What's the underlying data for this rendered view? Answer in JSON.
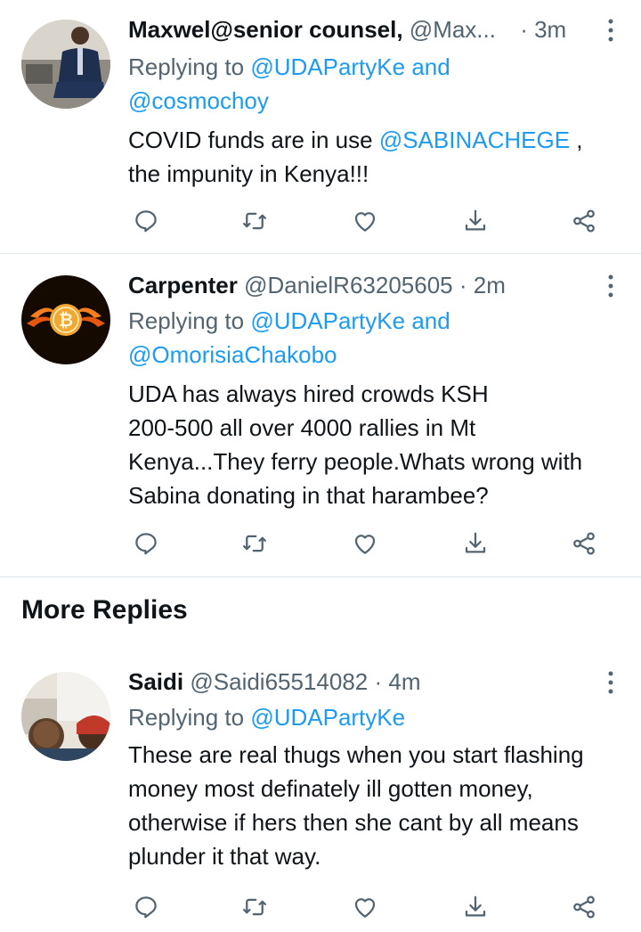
{
  "tweets": [
    {
      "name": "Maxwel@senior counsel,",
      "handle": "@Max...",
      "time": "· 3m",
      "replying_prefix": "Replying to",
      "replying_1": "@UDAPartyKe",
      "replying_and": "and",
      "replying_2": "@cosmochoy",
      "text_1": "COVID funds are in use ",
      "text_mention": "@SABINACHEGE",
      "text_2": " ,",
      "text_3": "the impunity in Kenya!!!"
    },
    {
      "name": "Carpenter",
      "handle": "@DanielR63205605",
      "time": "· 2m",
      "replying_prefix": "Replying to",
      "replying_1": "@UDAPartyKe",
      "replying_and": "and",
      "replying_2": "@OmorisiaChakobo",
      "line_1": "UDA has always hired crowds KSH",
      "line_2": "200-500 all over 4000 rallies in Mt",
      "line_3": "Kenya...They ferry people.Whats wrong with",
      "line_4": "Sabina donating in that harambee?"
    },
    {
      "name": "Saidi",
      "handle": "@Saidi65514082",
      "time": "· 4m",
      "replying_prefix": "Replying to",
      "replying_1": "@UDAPartyKe",
      "line_1": "These are real thugs when you start flashing",
      "line_2": "money most definately ill gotten money,",
      "line_3": "otherwise if hers then she cant by all means",
      "line_4": "plunder it that way."
    }
  ],
  "section": {
    "more_replies": "More Replies"
  },
  "icons": {
    "reply": "reply-icon",
    "retweet": "retweet-icon",
    "like": "heart-icon",
    "bookmark": "bookmark-download-icon",
    "share": "share-icon",
    "more": "more-vertical-icon"
  },
  "colors": {
    "link": "#1d9bf0",
    "secondary": "#536471",
    "text": "#0f1419",
    "divider": "#e1e8ed"
  }
}
